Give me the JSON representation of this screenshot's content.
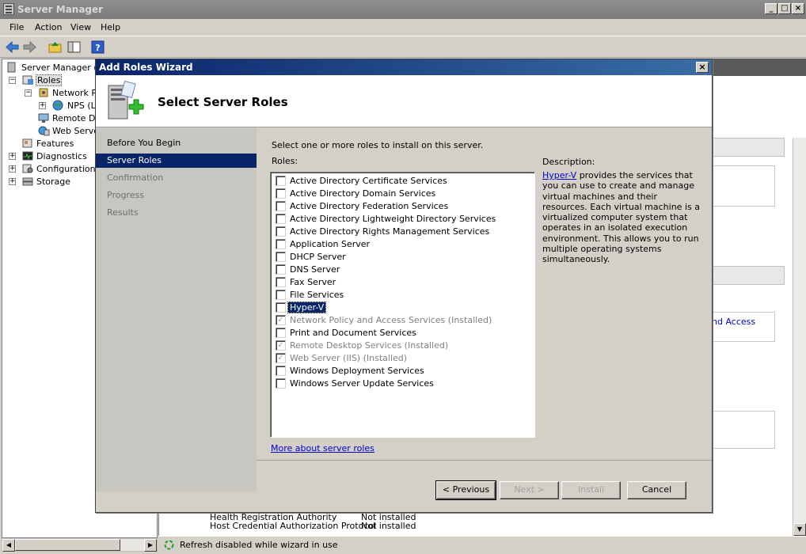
{
  "window": {
    "title": "Server Manager",
    "controls": [
      "_",
      "□",
      "×"
    ]
  },
  "menu": [
    "File",
    "Action",
    "View",
    "Help"
  ],
  "tree": {
    "root": "Server Manager (C",
    "roles": "Roles",
    "network_policy": "Network Po",
    "nps": "NPS (Lo",
    "remote_desktop": "Remote Des",
    "web_server": "Web Server",
    "features": "Features",
    "diagnostics": "Diagnostics",
    "configuration": "Configuration",
    "storage": "Storage"
  },
  "background": {
    "and_access": "nd Access",
    "row1_name": "Health Registration Authority",
    "row1_status": "Not installed",
    "row2_name": "Host Credential Authorization Protocol",
    "row2_status": "Not installed",
    "status": "Refresh disabled while wizard in use"
  },
  "wizard": {
    "title": "Add Roles Wizard",
    "close": "×",
    "heading": "Select Server Roles",
    "nav": [
      {
        "label": "Before You Begin",
        "state": "normal"
      },
      {
        "label": "Server Roles",
        "state": "selected"
      },
      {
        "label": "Confirmation",
        "state": "disabled"
      },
      {
        "label": "Progress",
        "state": "disabled"
      },
      {
        "label": "Results",
        "state": "disabled"
      }
    ],
    "instruction": "Select one or more roles to install on this server.",
    "roles_label": "Roles:",
    "roles": [
      {
        "label": "Active Directory Certificate Services",
        "checked": false,
        "disabled": false
      },
      {
        "label": "Active Directory Domain Services",
        "checked": false,
        "disabled": false
      },
      {
        "label": "Active Directory Federation Services",
        "checked": false,
        "disabled": false
      },
      {
        "label": "Active Directory Lightweight Directory Services",
        "checked": false,
        "disabled": false
      },
      {
        "label": "Active Directory Rights Management Services",
        "checked": false,
        "disabled": false
      },
      {
        "label": "Application Server",
        "checked": false,
        "disabled": false
      },
      {
        "label": "DHCP Server",
        "checked": false,
        "disabled": false
      },
      {
        "label": "DNS Server",
        "checked": false,
        "disabled": false
      },
      {
        "label": "Fax Server",
        "checked": false,
        "disabled": false
      },
      {
        "label": "File Services",
        "checked": false,
        "disabled": false
      },
      {
        "label": "Hyper-V",
        "checked": false,
        "disabled": false,
        "highlighted": true
      },
      {
        "label": "Network Policy and Access Services  (Installed)",
        "checked": true,
        "disabled": true
      },
      {
        "label": "Print and Document Services",
        "checked": false,
        "disabled": false
      },
      {
        "label": "Remote Desktop Services  (Installed)",
        "checked": true,
        "disabled": true
      },
      {
        "label": "Web Server (IIS)  (Installed)",
        "checked": true,
        "disabled": true
      },
      {
        "label": "Windows Deployment Services",
        "checked": false,
        "disabled": false
      },
      {
        "label": "Windows Server Update Services",
        "checked": false,
        "disabled": false
      }
    ],
    "description_label": "Description:",
    "description_link": "Hyper-V",
    "description_text": " provides the services that you can use to create and manage virtual machines and their resources. Each virtual machine is a virtualized computer system that operates in an isolated execution environment. This allows you to run multiple operating systems simultaneously.",
    "more_link": "More about server roles",
    "buttons": {
      "previous": "< Previous",
      "next": "Next >",
      "install": "Install",
      "cancel": "Cancel"
    }
  }
}
